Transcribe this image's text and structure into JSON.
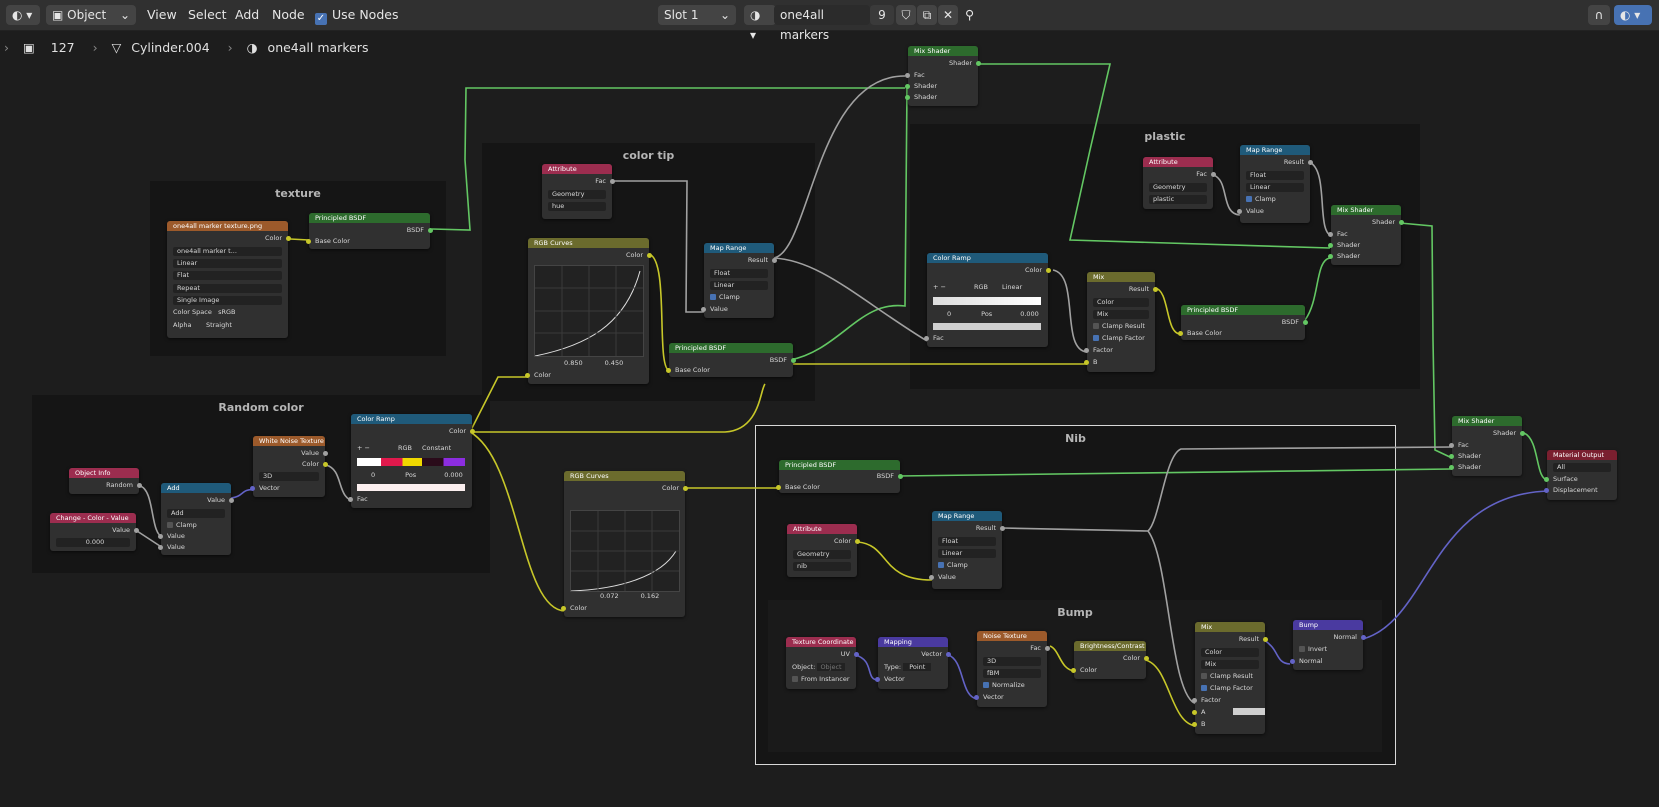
{
  "header": {
    "mode": "Object",
    "menus": [
      "View",
      "Select",
      "Add",
      "Node"
    ],
    "use_nodes_label": "Use Nodes",
    "slot": "Slot 1",
    "material_name": "one4all markers",
    "user_count": "9"
  },
  "breadcrumb": {
    "id": "127",
    "object": "Cylinder.004",
    "material": "one4all markers"
  },
  "frames": {
    "texture": "texture",
    "color_tip": "color tip",
    "plastic": "plastic",
    "random_color": "Random color",
    "nib": "Nib",
    "bump": "Bump"
  },
  "nodes": {
    "img_tex": {
      "title": "one4all marker texture.png",
      "out_color": "Color",
      "file": "one4all marker t...",
      "interp": "Linear",
      "proj": "Flat",
      "ext": "Repeat",
      "src": "Single Image",
      "cs_label": "Color Space",
      "cs_val": "sRGB",
      "alpha_label": "Alpha",
      "alpha_val": "Straight"
    },
    "p_bsdf_tex": {
      "title": "Principled BSDF",
      "out": "BSDF",
      "in": "Base Color"
    },
    "attr_hue": {
      "title": "Attribute",
      "out": "Fac",
      "type": "Geometry",
      "name": "hue"
    },
    "rgb_curves_1": {
      "title": "RGB Curves",
      "out": "Color",
      "in": "Color",
      "v1": "0.850",
      "v2": "0.450"
    },
    "map_range_1": {
      "title": "Map Range",
      "out": "Result",
      "dtype": "Float",
      "interp": "Linear",
      "clamp": "Clamp",
      "in": "Value"
    },
    "p_bsdf_tip": {
      "title": "Principled BSDF",
      "out": "BSDF",
      "in": "Base Color"
    },
    "mix_shader_top": {
      "title": "Mix Shader",
      "out": "Shader",
      "fac": "Fac",
      "s1": "Shader",
      "s2": "Shader"
    },
    "color_ramp_1": {
      "title": "Color Ramp",
      "out": "Color",
      "mode": "RGB",
      "interp": "Linear",
      "idx": "0",
      "pos_label": "Pos",
      "pos": "0.000",
      "in": "Fac"
    },
    "mix_1": {
      "title": "Mix",
      "out": "Result",
      "dtype": "Color",
      "blend": "Mix",
      "clamp_res": "Clamp Result",
      "clamp_fac": "Clamp Factor",
      "factor": "Factor",
      "b": "B"
    },
    "attr_plastic": {
      "title": "Attribute",
      "out": "Fac",
      "type": "Geometry",
      "name": "plastic"
    },
    "map_range_2": {
      "title": "Map Range",
      "out": "Result",
      "dtype": "Float",
      "interp": "Linear",
      "clamp": "Clamp",
      "in": "Value"
    },
    "p_bsdf_plastic": {
      "title": "Principled BSDF",
      "out": "BSDF",
      "in": "Base Color"
    },
    "mix_shader_plastic": {
      "title": "Mix Shader",
      "out": "Shader",
      "fac": "Fac",
      "s1": "Shader",
      "s2": "Shader"
    },
    "obj_info": {
      "title": "Object Info",
      "out": "Random"
    },
    "change_color": {
      "title": "Change - Color - Value",
      "out": "Value",
      "val": "0.000"
    },
    "add": {
      "title": "Add",
      "out": "Value",
      "op": "Add",
      "clamp": "Clamp",
      "in1": "Value",
      "in2": "Value"
    },
    "white_noise": {
      "title": "White Noise Texture",
      "out1": "Value",
      "out2": "Color",
      "dim": "3D",
      "in": "Vector"
    },
    "color_ramp_2": {
      "title": "Color Ramp",
      "out": "Color",
      "mode": "RGB",
      "interp": "Constant",
      "idx": "0",
      "pos_label": "Pos",
      "pos": "0.000",
      "in": "Fac"
    },
    "rgb_curves_2": {
      "title": "RGB Curves",
      "out": "Color",
      "in": "Color",
      "v1": "0.072",
      "v2": "0.162"
    },
    "p_bsdf_nib": {
      "title": "Principled BSDF",
      "out": "BSDF",
      "in": "Base Color"
    },
    "attr_nib": {
      "title": "Attribute",
      "out": "Color",
      "type": "Geometry",
      "name": "nib"
    },
    "map_range_3": {
      "title": "Map Range",
      "out": "Result",
      "dtype": "Float",
      "interp": "Linear",
      "clamp": "Clamp",
      "in": "Value"
    },
    "tex_coord": {
      "title": "Texture Coordinate",
      "out": "UV",
      "obj_label": "Object:",
      "obj_ph": "Object",
      "from_inst": "From Instancer"
    },
    "mapping": {
      "title": "Mapping",
      "out": "Vector",
      "type_label": "Type:",
      "type": "Point",
      "in": "Vector"
    },
    "noise": {
      "title": "Noise Texture",
      "out": "Fac",
      "dim": "3D",
      "basis": "fBM",
      "normalize": "Normalize",
      "in": "Vector"
    },
    "bright": {
      "title": "Brightness/Contrast",
      "out": "Color",
      "in": "Color"
    },
    "mix_2": {
      "title": "Mix",
      "out": "Result",
      "dtype": "Color",
      "blend": "Mix",
      "clamp_res": "Clamp Result",
      "clamp_fac": "Clamp Factor",
      "factor": "Factor",
      "a": "A",
      "b": "B"
    },
    "bump": {
      "title": "Bump",
      "out": "Normal",
      "invert": "Invert",
      "in": "Normal"
    },
    "mix_shader_final": {
      "title": "Mix Shader",
      "out": "Shader",
      "fac": "Fac",
      "s1": "Shader",
      "s2": "Shader"
    },
    "mat_out": {
      "title": "Material Output",
      "target": "All",
      "surface": "Surface",
      "disp": "Displacement"
    }
  }
}
